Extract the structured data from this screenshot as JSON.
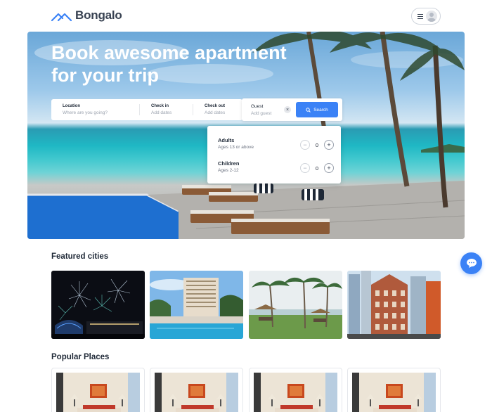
{
  "header": {
    "logo_text": "Bongalo",
    "menu_icon": "hamburger-icon",
    "avatar_icon": "user-avatar-icon"
  },
  "hero": {
    "title": "Book awesome apartment for your trip"
  },
  "search": {
    "location_label": "Location",
    "location_placeholder": "Where are you going?",
    "checkin_label": "Check in",
    "checkin_placeholder": "Add dates",
    "checkout_label": "Check out",
    "checkout_placeholder": "Add dates",
    "guest_label": "Guest",
    "guest_placeholder": "Add guest",
    "search_button": "Search"
  },
  "guests": {
    "adults_label": "Adults",
    "adults_sub": "Ages 13 or above",
    "adults_count": "0",
    "children_label": "Children",
    "children_sub": "Ages 2-12",
    "children_count": "0"
  },
  "featured": {
    "title": "Featured cities"
  },
  "popular": {
    "title": "Popular Places"
  },
  "colors": {
    "accent": "#3b82f6",
    "text": "#1f2937"
  }
}
